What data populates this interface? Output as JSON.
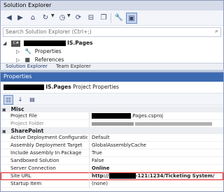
{
  "solution_explorer": {
    "title": "Solution Explorer",
    "search_placeholder": "Search Solution Explorer (Ctrl+;)",
    "tree": {
      "project_name_suffix": "IS.Pages",
      "items": [
        "Properties",
        "References"
      ]
    },
    "tabs": [
      "Solution Explorer",
      "Team Explorer"
    ]
  },
  "properties": {
    "title": "Properties",
    "subject_suffix": "IS.Pages",
    "subject_type": "Project Properties",
    "categories": [
      {
        "name": "Misc",
        "rows": [
          {
            "name": "Project File",
            "value": ".Pages.csproj"
          },
          {
            "name": "Project Folder",
            "value": ""
          }
        ]
      },
      {
        "name": "SharePoint",
        "rows": [
          {
            "name": "Active Deployment Configuration",
            "value": "Default"
          },
          {
            "name": "Assembly Deployment Target",
            "value": "GlobalAssemblyCache"
          },
          {
            "name": "Include Assembly In Package",
            "value": "True"
          },
          {
            "name": "Sandboxed Solution",
            "value": "False"
          },
          {
            "name": "Server Connection",
            "value": "Online"
          },
          {
            "name": "Site URL",
            "value_prefix": "http://",
            "value": "-121:1234/Ticketing System/"
          },
          {
            "name": "Startup Item",
            "value": "(none)"
          }
        ]
      }
    ]
  },
  "colors": {
    "title_bar_active": "#3c6ab2",
    "highlight_outline": "#e21c1c"
  }
}
